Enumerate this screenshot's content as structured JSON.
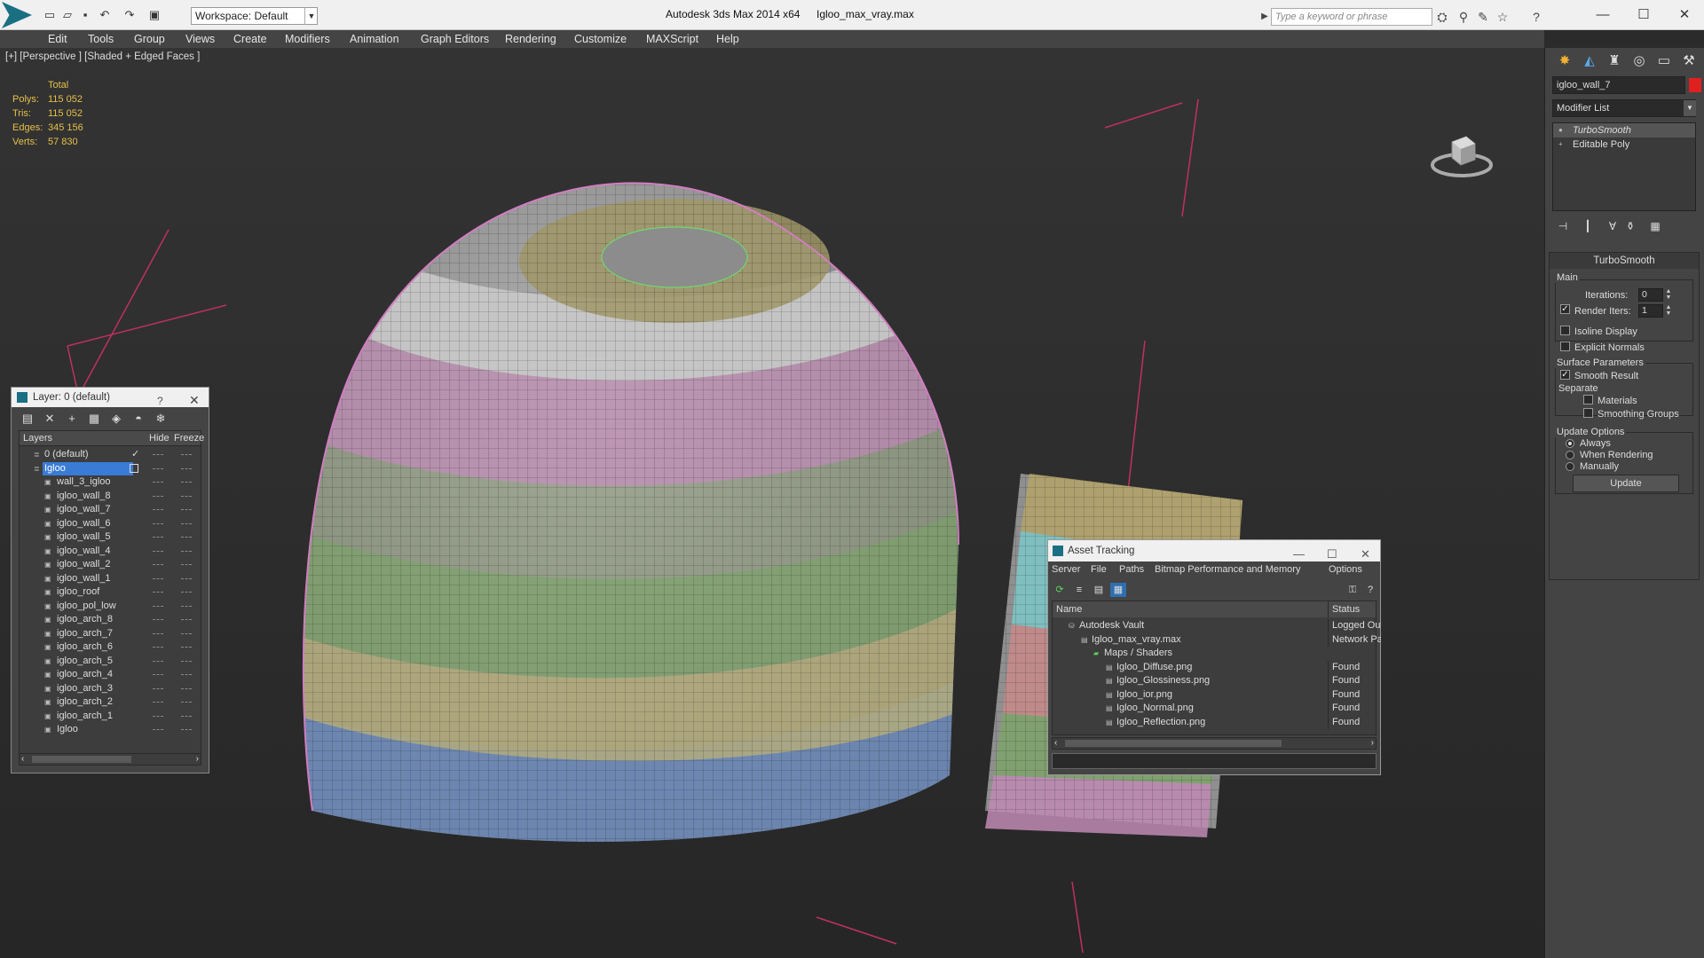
{
  "app": {
    "title": "Autodesk 3ds Max  2014 x64",
    "file": "Igloo_max_vray.max",
    "workspace": "Workspace: Default",
    "search_placeholder": "Type a keyword or phrase"
  },
  "menus": [
    "Edit",
    "Tools",
    "Group",
    "Views",
    "Create",
    "Modifiers",
    "Animation",
    "Graph Editors",
    "Rendering",
    "Customize",
    "MAXScript",
    "Help"
  ],
  "viewport": {
    "label": "[+] [Perspective ] [Shaded + Edged Faces ]",
    "stats_header": "Total",
    "stats": [
      {
        "label": "Polys:",
        "value": "115 052"
      },
      {
        "label": "Tris:",
        "value": "115 052"
      },
      {
        "label": "Edges:",
        "value": "345 156"
      },
      {
        "label": "Verts:",
        "value": "57 830"
      }
    ]
  },
  "command_panel": {
    "object_name": "igloo_wall_7",
    "object_color": "#e02020",
    "modifier_list": "Modifier List",
    "stack": [
      "TurboSmooth",
      "Editable Poly"
    ],
    "rollout_title": "TurboSmooth",
    "main_label": "Main",
    "iterations_label": "Iterations:",
    "iterations_value": "0",
    "render_iters_label": "Render Iters:",
    "render_iters_value": "1",
    "isoline_label": "Isoline Display",
    "explicit_normals_label": "Explicit Normals",
    "surface_params_label": "Surface Parameters",
    "smooth_result_label": "Smooth Result",
    "separate_label": "Separate",
    "materials_label": "Materials",
    "smoothing_groups_label": "Smoothing Groups",
    "update_options_label": "Update Options",
    "always_label": "Always",
    "when_rendering_label": "When Rendering",
    "manually_label": "Manually",
    "update_button": "Update"
  },
  "layer_window": {
    "title": "Layer: 0 (default)",
    "help": "?",
    "col_layers": "Layers",
    "col_hide": "Hide",
    "col_freeze": "Freeze",
    "rows": [
      {
        "name": "0 (default)",
        "level": 0
      },
      {
        "name": "Igloo",
        "level": 0
      },
      {
        "name": "wall_3_igloo",
        "level": 1
      },
      {
        "name": "igloo_wall_8",
        "level": 1
      },
      {
        "name": "igloo_wall_7",
        "level": 1
      },
      {
        "name": "igloo_wall_6",
        "level": 1
      },
      {
        "name": "igloo_wall_5",
        "level": 1
      },
      {
        "name": "igloo_wall_4",
        "level": 1
      },
      {
        "name": "igloo_wall_2",
        "level": 1
      },
      {
        "name": "igloo_wall_1",
        "level": 1
      },
      {
        "name": "igloo_roof",
        "level": 1
      },
      {
        "name": "igloo_pol_low",
        "level": 1
      },
      {
        "name": "igloo_arch_8",
        "level": 1
      },
      {
        "name": "igloo_arch_7",
        "level": 1
      },
      {
        "name": "igloo_arch_6",
        "level": 1
      },
      {
        "name": "igloo_arch_5",
        "level": 1
      },
      {
        "name": "igloo_arch_4",
        "level": 1
      },
      {
        "name": "igloo_arch_3",
        "level": 1
      },
      {
        "name": "igloo_arch_2",
        "level": 1
      },
      {
        "name": "igloo_arch_1",
        "level": 1
      },
      {
        "name": "Igloo",
        "level": 1
      }
    ]
  },
  "asset_tracking": {
    "title": "Asset Tracking",
    "menus": [
      "Server",
      "File",
      "Paths",
      "Bitmap Performance and Memory",
      "Options"
    ],
    "col_name": "Name",
    "col_status": "Status",
    "rows": [
      {
        "name": "Autodesk Vault",
        "status": "Logged Out ...",
        "level": 0
      },
      {
        "name": "Igloo_max_vray.max",
        "status": "Network Path",
        "level": 1
      },
      {
        "name": "Maps / Shaders",
        "status": "",
        "level": 2
      },
      {
        "name": "Igloo_Diffuse.png",
        "status": "Found",
        "level": 3
      },
      {
        "name": "Igloo_Glossiness.png",
        "status": "Found",
        "level": 3
      },
      {
        "name": "Igloo_ior.png",
        "status": "Found",
        "level": 3
      },
      {
        "name": "Igloo_Normal.png",
        "status": "Found",
        "level": 3
      },
      {
        "name": "Igloo_Reflection.png",
        "status": "Found",
        "level": 3
      }
    ]
  }
}
